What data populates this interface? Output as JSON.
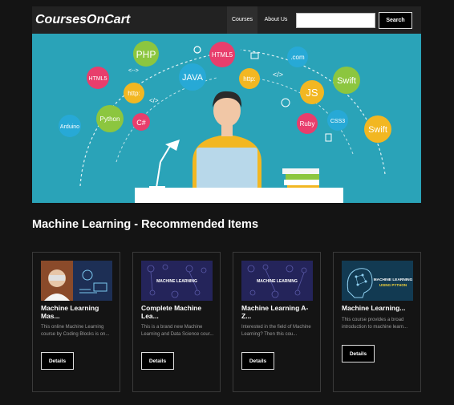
{
  "navbar": {
    "brand": "CoursesOnCart",
    "links": [
      "Courses",
      "About Us"
    ],
    "search_placeholder": "",
    "search_button": "Search"
  },
  "hero": {
    "bubbles": [
      "PHP",
      "HTML5",
      "JAVA",
      ".com",
      "HTML5",
      "<-->",
      "http:",
      "http:",
      "</>",
      "JS",
      "Swift",
      "Python",
      "C#",
      "</>",
      "Arduino",
      "Ruby",
      "CSS3",
      "Swift"
    ],
    "colors": {
      "background": "#2aa3b8",
      "shirt": "#f2b722",
      "laptop": "#b8d8ea",
      "desk": "#ffffff"
    }
  },
  "section": {
    "title": "Machine Learning - Recommended Items"
  },
  "cards": [
    {
      "title": "Machine Learning Mas...",
      "description": "This online Machine Learning course by Coding Blocks is on...",
      "button": "Details",
      "thumb_icon": "person-vr-thumbnail-icon"
    },
    {
      "title": "Complete Machine Lea...",
      "description": "This is a brand new Machine Learning and Data Science cour...",
      "button": "Details",
      "thumb_icon": "machine-learning-thumbnail-icon",
      "thumb_text": "MACHINE LEARNING"
    },
    {
      "title": "Machine Learning A-Z...",
      "description": "Interested in the field of Machine Learning? Then this cou...",
      "button": "Details",
      "thumb_icon": "machine-learning-thumbnail-icon",
      "thumb_text": "MACHINE LEARNING"
    },
    {
      "title": "Machine Learning...",
      "description": "This course provides a broad introduction to machine learn...",
      "button": "Details",
      "thumb_icon": "brain-python-thumbnail-icon",
      "thumb_text": "MACHINE LEARNING",
      "thumb_subtext": "USING PYTHON"
    }
  ],
  "colors": {
    "page_bg": "#141414",
    "navbar_bg": "#222222",
    "card_border": "#3a3a3a",
    "desc_text": "#999999"
  }
}
